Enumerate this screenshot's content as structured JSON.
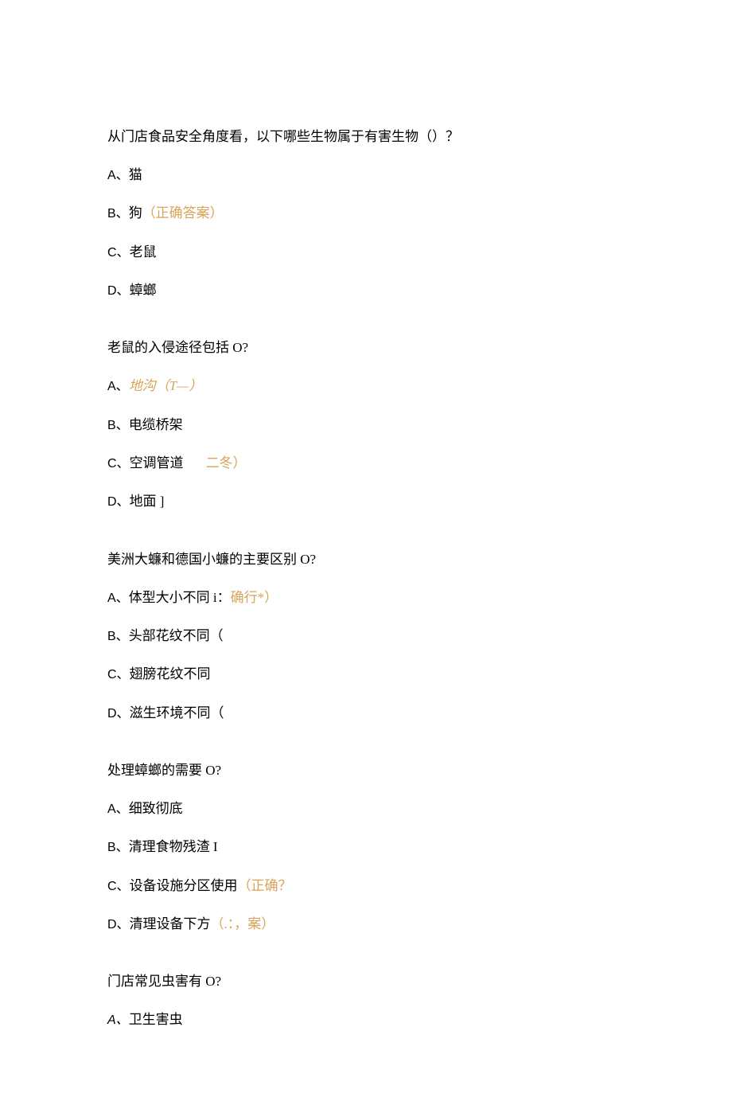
{
  "q1": {
    "text": "从门店食品安全角度看，以下哪些生物属于有害生物（）？",
    "a_label": "A、",
    "a_text": "猫",
    "b_label": "B、",
    "b_text": "狗",
    "b_ans": "（正确答案）",
    "c_label": "C、",
    "c_text": "老鼠",
    "d_label": "D、",
    "d_text": "蟑螂"
  },
  "q2": {
    "text": "老鼠的入侵途径包括 O?",
    "a_label": "A、",
    "a_text": "地沟（T—）",
    "b_label": "B、",
    "b_text": "电缆桥架",
    "c_label": "C、",
    "c_text": "空调管道",
    "c_note": "二冬）",
    "d_label": "D、",
    "d_text": "地面 ]"
  },
  "q3": {
    "text": "美洲大蠊和德国小蠊的主要区别 O?",
    "a_label": "A、",
    "a_text": "体型大小不同 i：",
    "a_ans": "确行*）",
    "b_label": "B、",
    "b_text": "头部花纹不同（",
    "c_label": "C、",
    "c_text": "翅膀花纹不同",
    "d_label": "D、",
    "d_text": "滋生环境不同（"
  },
  "q4": {
    "text": "处理蟑螂的需要 O?",
    "a_label": "A、",
    "a_text": "细致彻底",
    "b_label": "B、",
    "b_text": "清理食物残渣 I",
    "c_label": "C、",
    "c_text": "设备设施分区使用",
    "c_ans": "（正确？",
    "d_label": "D、",
    "d_text": "清理设备下方",
    "d_ans": "（.：，案）"
  },
  "q5": {
    "text": "门店常见虫害有 O?",
    "a_label": "A、",
    "a_text": "卫生害虫"
  }
}
